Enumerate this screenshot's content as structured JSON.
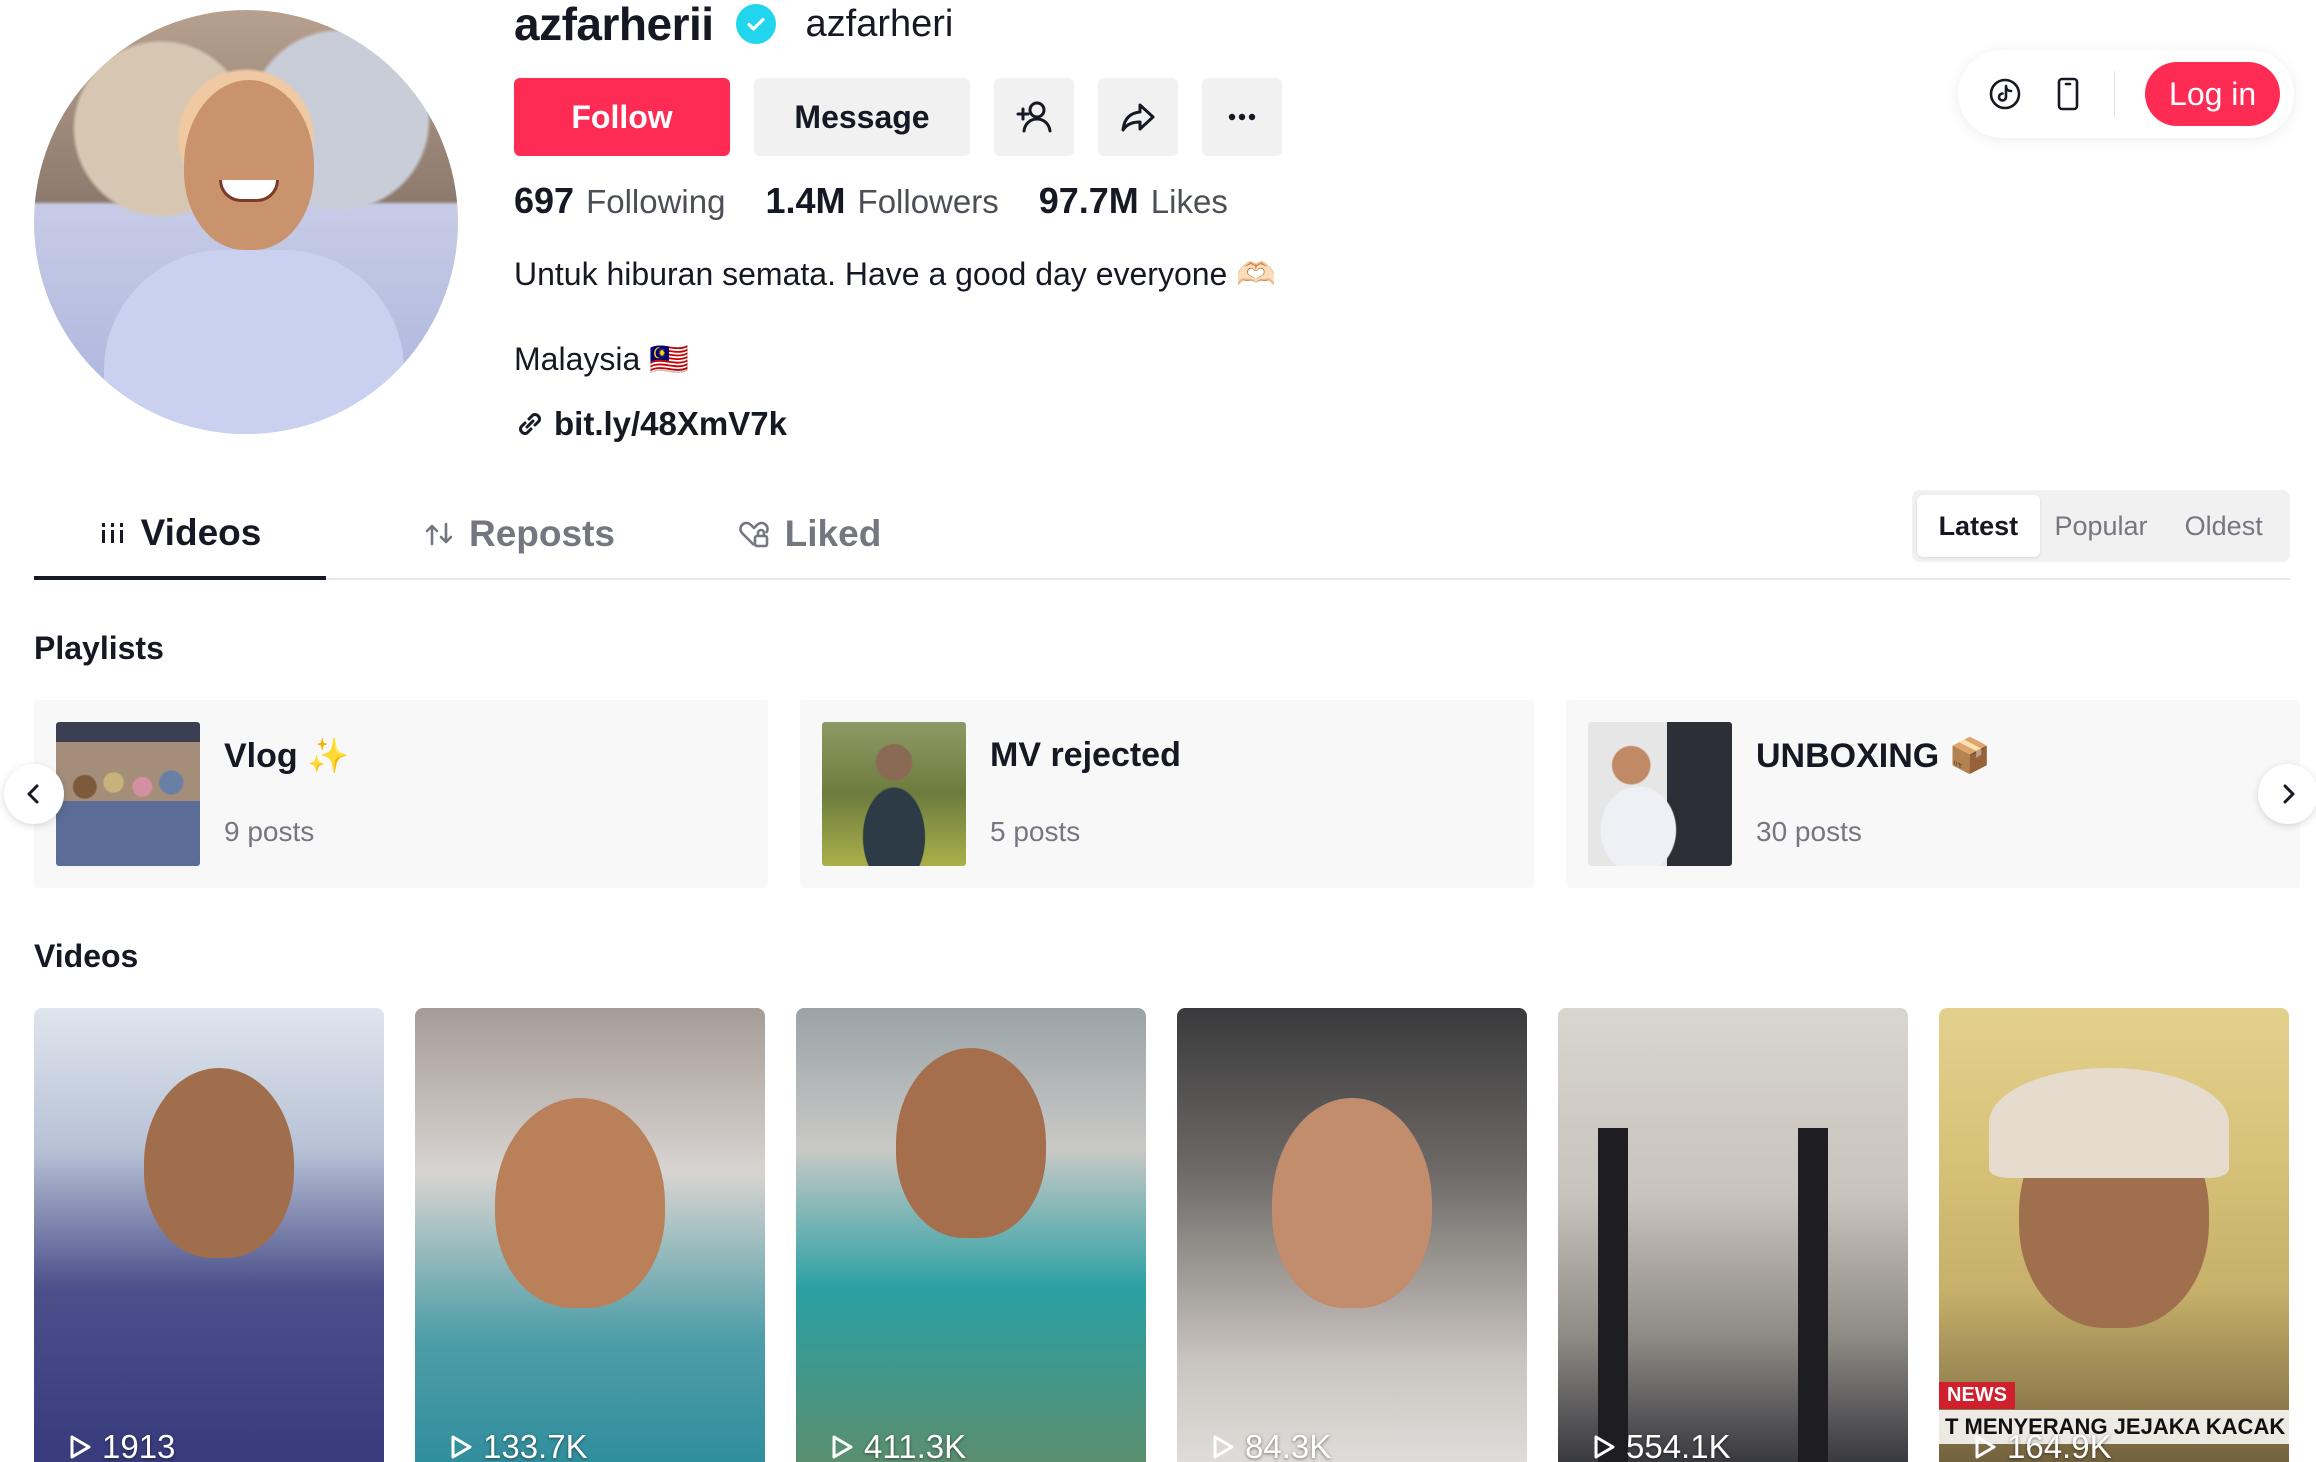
{
  "profile": {
    "username": "azfarherii",
    "nickname": "azfarheri",
    "follow_label": "Follow",
    "message_label": "Message",
    "stats": [
      {
        "value": "697",
        "label": "Following"
      },
      {
        "value": "1.4M",
        "label": "Followers"
      },
      {
        "value": "97.7M",
        "label": "Likes"
      }
    ],
    "bio": "Untuk hiburan semata. Have a good day everyone 🫶🏻",
    "location": "Malaysia 🇲🇾",
    "link": "bit.ly/48XmV7k"
  },
  "topbar": {
    "login_label": "Log in"
  },
  "tabs": [
    {
      "label": "Videos"
    },
    {
      "label": "Reposts"
    },
    {
      "label": "Liked"
    }
  ],
  "sort": [
    {
      "label": "Latest"
    },
    {
      "label": "Popular"
    },
    {
      "label": "Oldest"
    }
  ],
  "playlists_title": "Playlists",
  "playlists": [
    {
      "title": "Vlog ✨",
      "count": "9 posts"
    },
    {
      "title": "MV rejected",
      "count": "5 posts"
    },
    {
      "title": "UNBOXING 📦",
      "count": "30 posts"
    }
  ],
  "videos_title": "Videos",
  "videos": [
    {
      "views": "1913"
    },
    {
      "views": "133.7K"
    },
    {
      "views": "411.3K"
    },
    {
      "views": "84.3K"
    },
    {
      "views": "554.1K"
    },
    {
      "views": "164.9K"
    }
  ],
  "news_overlay": {
    "badge": "NEWS",
    "ticker": "T MENYERANG JEJAKA KACAK"
  },
  "colors": {
    "brand": "#fe2c55",
    "verified": "#20d5ec",
    "text": "#161823",
    "muted": "#757780"
  }
}
